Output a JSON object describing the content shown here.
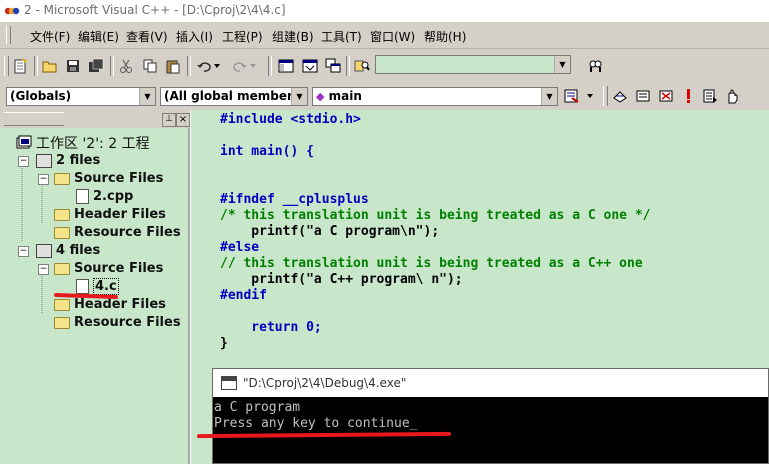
{
  "window": {
    "title": "2 - Microsoft Visual C++ - [D:\\Cproj\\2\\4\\4.c]"
  },
  "menu": [
    "文件(F)",
    "编辑(E)",
    "查看(V)",
    "插入(I)",
    "工程(P)",
    "组建(B)",
    "工具(T)",
    "窗口(W)",
    "帮助(H)"
  ],
  "toolbar": {
    "find_value": ""
  },
  "wizardbar": {
    "class_combo": "(Globals)",
    "filter_combo": "(All global members",
    "member_combo": "main"
  },
  "workspace": {
    "root": "工作区 '2': 2 工程",
    "projects": [
      {
        "name": "2 files",
        "folders": [
          {
            "name": "Source Files",
            "files": [
              "2.cpp"
            ]
          },
          {
            "name": "Header Files",
            "files": []
          },
          {
            "name": "Resource Files",
            "files": []
          }
        ]
      },
      {
        "name": "4 files",
        "folders": [
          {
            "name": "Source Files",
            "files": [
              "4.c"
            ]
          },
          {
            "name": "Header Files",
            "files": []
          },
          {
            "name": "Resource Files",
            "files": []
          }
        ]
      }
    ]
  },
  "editor": {
    "lines": [
      "#include <stdio.h>",
      "",
      "int main() {",
      "",
      "",
      "#ifndef __cplusplus",
      "/* this translation unit is being treated as a C one */",
      "    printf(\"a C program\\n\");",
      "#else",
      "// this translation unit is being treated as a C++ one",
      "    printf(\"a C++ program\\ n\");",
      "#endif",
      "",
      "    return 0;",
      "}"
    ]
  },
  "console": {
    "title": "\"D:\\Cproj\\2\\4\\Debug\\4.exe\"",
    "lines": [
      "a C program",
      "Press any key to continue_"
    ]
  },
  "colors": {
    "editor_bg": "#c8e6c9",
    "keyword": "#0000c0",
    "comment": "#008000",
    "annotation_red": "#e8191d"
  }
}
